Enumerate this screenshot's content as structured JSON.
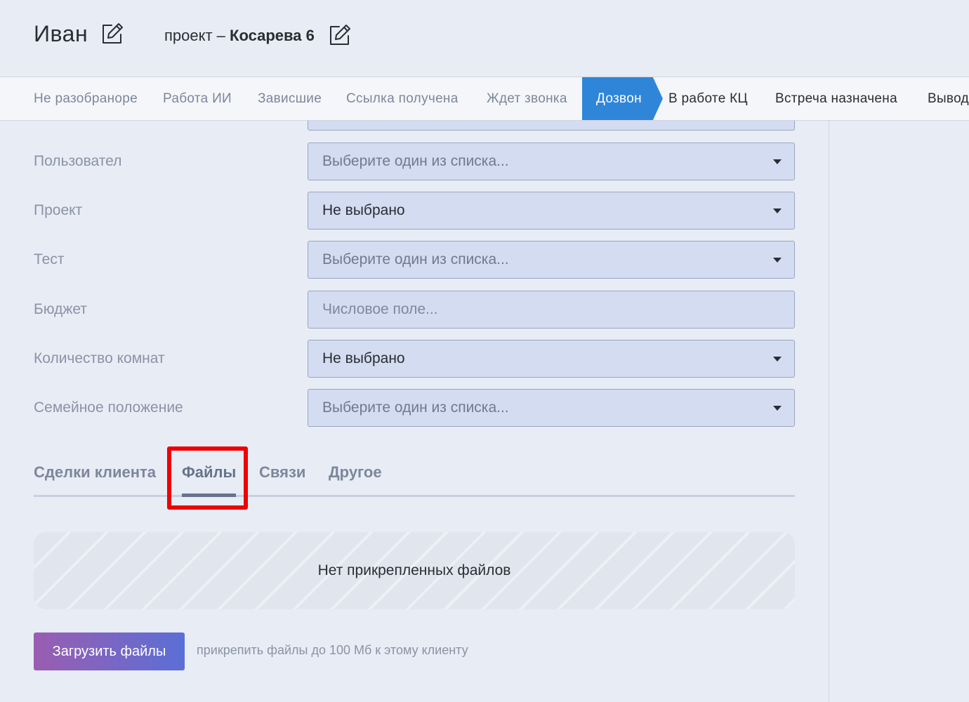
{
  "header": {
    "client_name": "Иван",
    "project_prefix": "проект – ",
    "project_name": "Косарева 6"
  },
  "pipeline": {
    "stages": [
      {
        "label": "Не разобраноре",
        "state": "before"
      },
      {
        "label": "Работа ИИ",
        "state": "before"
      },
      {
        "label": "Зависшие",
        "state": "before"
      },
      {
        "label": "Ссылка получена",
        "state": "before"
      },
      {
        "label": "Ждет звонка",
        "state": "before"
      },
      {
        "label": "Дозвон",
        "state": "active"
      },
      {
        "label": "В работе КЦ",
        "state": "after"
      },
      {
        "label": "Встреча назначена",
        "state": "after"
      },
      {
        "label": "Вывод",
        "state": "after"
      }
    ]
  },
  "form": {
    "fields": [
      {
        "label": "Пользовател",
        "value": "Выберите один из списка...",
        "kind": "select",
        "is_placeholder": true
      },
      {
        "label": "Проект",
        "value": "Не выбрано",
        "kind": "select",
        "is_placeholder": false
      },
      {
        "label": "Тест",
        "value": "Выберите один из списка...",
        "kind": "select",
        "is_placeholder": true
      },
      {
        "label": "Бюджет",
        "placeholder": "Числовое поле...",
        "kind": "number"
      },
      {
        "label": "Количество комнат",
        "value": "Не выбрано",
        "kind": "select",
        "is_placeholder": false
      },
      {
        "label": "Семейное положение",
        "value": "Выберите один из списка...",
        "kind": "select",
        "is_placeholder": true
      }
    ]
  },
  "tabs": {
    "items": [
      {
        "label": "Сделки клиента",
        "active": false
      },
      {
        "label": "Файлы",
        "active": true
      },
      {
        "label": "Связи",
        "active": false
      },
      {
        "label": "Другое",
        "active": false
      }
    ]
  },
  "files": {
    "empty_text": "Нет прикрепленных файлов",
    "upload_label": "Загрузить файлы",
    "upload_hint": "прикрепить файлы до 100 Мб к этому клиенту"
  },
  "colors": {
    "accent": "#2f86d9",
    "highlight": "#ee0000",
    "upload_gradient_start": "#9a5db0",
    "upload_gradient_end": "#5b6fd6"
  },
  "icons": {
    "edit_name": "edit-icon",
    "edit_project": "edit-icon"
  }
}
